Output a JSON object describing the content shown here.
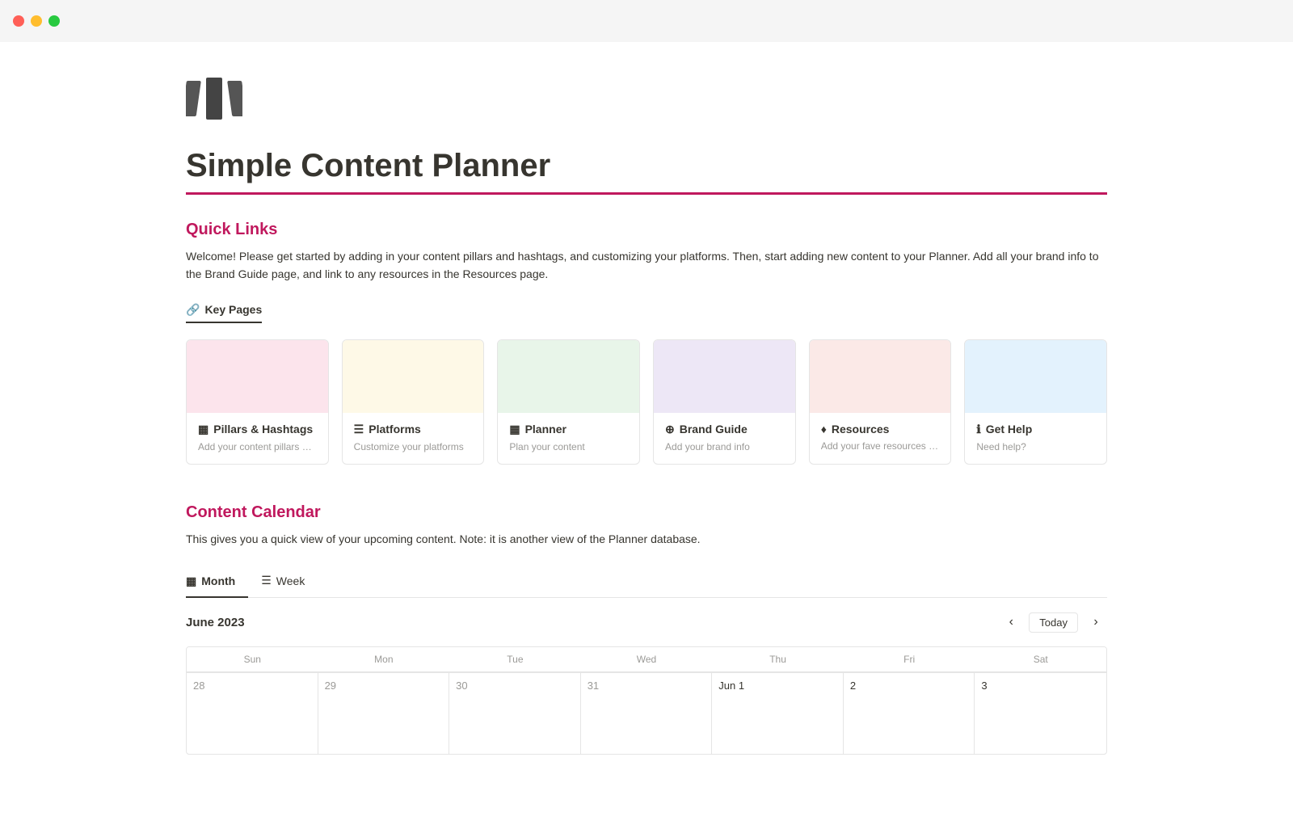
{
  "titlebar": {
    "dots": [
      "red",
      "yellow",
      "green"
    ]
  },
  "page": {
    "title": "Simple Content Planner",
    "divider_color": "#c0185d"
  },
  "quick_links": {
    "section_title": "Quick Links",
    "description": "Welcome! Please get started by adding in your content pillars and hashtags, and customizing your platforms. Then, start adding new content to your Planner. Add all your brand info to the Brand Guide page, and link to any resources in the Resources page.",
    "key_pages_label": "Key Pages",
    "cards": [
      {
        "id": "pillars",
        "color": "#fce4ec",
        "icon": "▦",
        "title": "Pillars & Hashtags",
        "subtitle": "Add your content pillars & hasht..."
      },
      {
        "id": "platforms",
        "color": "#fef9e7",
        "icon": "☰",
        "title": "Platforms",
        "subtitle": "Customize your platforms"
      },
      {
        "id": "planner",
        "color": "#e8f5e9",
        "icon": "▦",
        "title": "Planner",
        "subtitle": "Plan your content"
      },
      {
        "id": "brand-guide",
        "color": "#ede7f6",
        "icon": "⊕",
        "title": "Brand Guide",
        "subtitle": "Add your brand info"
      },
      {
        "id": "resources",
        "color": "#fbe9e7",
        "icon": "♦",
        "title": "Resources",
        "subtitle": "Add your fave resources here"
      },
      {
        "id": "get-help",
        "color": "#e3f2fd",
        "icon": "ℹ",
        "title": "Get Help",
        "subtitle": "Need help?"
      }
    ]
  },
  "content_calendar": {
    "section_title": "Content Calendar",
    "description": "This gives you a quick view of your upcoming content. Note: it is another view of the Planner database.",
    "tabs": [
      {
        "id": "month",
        "label": "Month",
        "icon": "▦",
        "active": true
      },
      {
        "id": "week",
        "label": "Week",
        "icon": "☰",
        "active": false
      }
    ],
    "month": "June 2023",
    "today_label": "Today",
    "day_headers": [
      "Sun",
      "Mon",
      "Tue",
      "Wed",
      "Thu",
      "Fri",
      "Sat"
    ],
    "weeks": [
      [
        {
          "num": "28",
          "current": false
        },
        {
          "num": "29",
          "current": false
        },
        {
          "num": "30",
          "current": false
        },
        {
          "num": "31",
          "current": false
        },
        {
          "num": "Jun 1",
          "current": true
        },
        {
          "num": "2",
          "current": true
        },
        {
          "num": "3",
          "current": true
        }
      ]
    ]
  }
}
